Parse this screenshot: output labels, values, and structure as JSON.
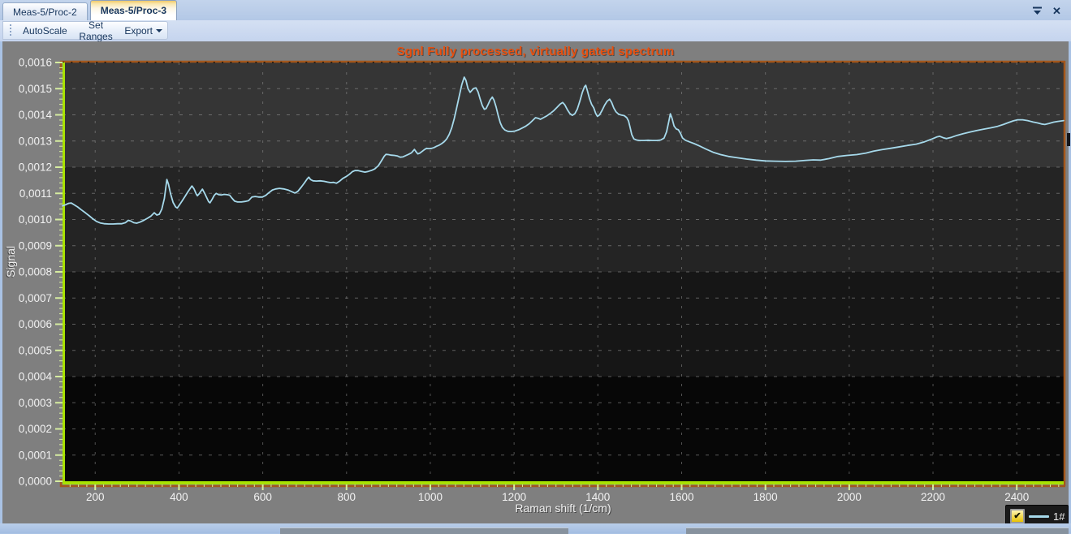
{
  "tab_bar": {
    "tabs": [
      {
        "label": "Meas-5/Proc-2",
        "active": false
      },
      {
        "label": "Meas-5/Proc-3",
        "active": true
      }
    ]
  },
  "toolbar": {
    "autoscale_label": "AutoScale",
    "set_ranges_label": "Set Ranges",
    "export_label": "Export"
  },
  "chart_data": {
    "type": "line",
    "title": "Sgnl Fully processed, virtually gated spectrum",
    "title_color": "#e8500f",
    "xlabel": "Raman shift (1/cm)",
    "ylabel": "Signal",
    "xlim": [
      122,
      2512
    ],
    "ylim": [
      0,
      0.0016
    ],
    "x_tick_start": 200,
    "x_tick_step": 200,
    "x_tick_end": 2400,
    "x_minor_step": 20,
    "y_tick_step": 0.0001,
    "y_minor_step": 2e-05,
    "y_decimals": 4,
    "decimal_separator": ",",
    "grid": "dashed",
    "grid_color": "#9a9a9a",
    "axis_color": "#a8e202",
    "tick_color": "#d6eda0",
    "frame_color": "#a4571c",
    "label_color": "#f2f2f2",
    "plot_bands": [
      {
        "from": 0.0012,
        "to": 0.0016,
        "color": "#353535"
      },
      {
        "from": 0.0008,
        "to": 0.0012,
        "color": "#242424"
      },
      {
        "from": 0.0004,
        "to": 0.0008,
        "color": "#161616"
      },
      {
        "from": 0.0,
        "to": 0.0004,
        "color": "#070707"
      }
    ],
    "legend": {
      "position": "bottom-right",
      "entries": [
        {
          "label": "1#",
          "checked": true,
          "checkbox_color": "#e9c300"
        }
      ]
    },
    "series": [
      {
        "name": "1#",
        "color": "#a6d9eb",
        "points": [
          [
            122,
            0.001052
          ],
          [
            130,
            0.001057
          ],
          [
            137,
            0.001062
          ],
          [
            143,
            0.001063
          ],
          [
            150,
            0.001056
          ],
          [
            158,
            0.001048
          ],
          [
            166,
            0.001038
          ],
          [
            177,
            0.001025
          ],
          [
            186,
            0.001014
          ],
          [
            195,
            0.001002
          ],
          [
            203,
            0.000993
          ],
          [
            212,
            0.000987
          ],
          [
            222,
            0.000984
          ],
          [
            232,
            0.000983
          ],
          [
            243,
            0.000983
          ],
          [
            254,
            0.000984
          ],
          [
            263,
            0.000984
          ],
          [
            272,
            0.000988
          ],
          [
            279,
            0.000997
          ],
          [
            285,
            0.000994
          ],
          [
            292,
            0.000988
          ],
          [
            299,
            0.000986
          ],
          [
            307,
            0.00099
          ],
          [
            316,
            0.000997
          ],
          [
            325,
            0.001005
          ],
          [
            333,
            0.001013
          ],
          [
            341,
            0.001026
          ],
          [
            347,
            0.001017
          ],
          [
            353,
            0.00102
          ],
          [
            359,
            0.00104
          ],
          [
            365,
            0.00108
          ],
          [
            371,
            0.001153
          ],
          [
            375,
            0.001135
          ],
          [
            380,
            0.001098
          ],
          [
            386,
            0.001065
          ],
          [
            392,
            0.001048
          ],
          [
            396,
            0.001044
          ],
          [
            402,
            0.001058
          ],
          [
            408,
            0.001072
          ],
          [
            415,
            0.00109
          ],
          [
            422,
            0.001108
          ],
          [
            428,
            0.001122
          ],
          [
            431,
            0.001128
          ],
          [
            436,
            0.001117
          ],
          [
            441,
            0.001098
          ],
          [
            444,
            0.001091
          ],
          [
            448,
            0.001098
          ],
          [
            453,
            0.00111
          ],
          [
            456,
            0.001116
          ],
          [
            461,
            0.001101
          ],
          [
            466,
            0.001084
          ],
          [
            471,
            0.001068
          ],
          [
            474,
            0.001064
          ],
          [
            479,
            0.001077
          ],
          [
            484,
            0.001092
          ],
          [
            489,
            0.0011
          ],
          [
            495,
            0.001095
          ],
          [
            501,
            0.001094
          ],
          [
            508,
            0.001096
          ],
          [
            515,
            0.001095
          ],
          [
            521,
            0.001093
          ],
          [
            527,
            0.001081
          ],
          [
            533,
            0.00107
          ],
          [
            540,
            0.001067
          ],
          [
            549,
            0.001067
          ],
          [
            558,
            0.001069
          ],
          [
            566,
            0.001072
          ],
          [
            574,
            0.001086
          ],
          [
            582,
            0.001088
          ],
          [
            590,
            0.001086
          ],
          [
            599,
            0.001086
          ],
          [
            607,
            0.001092
          ],
          [
            615,
            0.001103
          ],
          [
            623,
            0.001113
          ],
          [
            631,
            0.001117
          ],
          [
            640,
            0.001119
          ],
          [
            650,
            0.001117
          ],
          [
            660,
            0.001113
          ],
          [
            670,
            0.001106
          ],
          [
            677,
            0.001101
          ],
          [
            684,
            0.001108
          ],
          [
            692,
            0.001124
          ],
          [
            700,
            0.001141
          ],
          [
            706,
            0.001155
          ],
          [
            710,
            0.001162
          ],
          [
            714,
            0.001153
          ],
          [
            720,
            0.001148
          ],
          [
            728,
            0.001147
          ],
          [
            737,
            0.001148
          ],
          [
            746,
            0.001146
          ],
          [
            755,
            0.001143
          ],
          [
            762,
            0.001141
          ],
          [
            769,
            0.001142
          ],
          [
            776,
            0.001139
          ],
          [
            783,
            0.001146
          ],
          [
            791,
            0.001157
          ],
          [
            799,
            0.001164
          ],
          [
            807,
            0.001173
          ],
          [
            814,
            0.001183
          ],
          [
            820,
            0.001187
          ],
          [
            828,
            0.001187
          ],
          [
            836,
            0.001184
          ],
          [
            844,
            0.001181
          ],
          [
            852,
            0.001184
          ],
          [
            860,
            0.001188
          ],
          [
            868,
            0.001194
          ],
          [
            876,
            0.001206
          ],
          [
            884,
            0.001226
          ],
          [
            890,
            0.001242
          ],
          [
            894,
            0.001249
          ],
          [
            900,
            0.001248
          ],
          [
            907,
            0.001246
          ],
          [
            914,
            0.001245
          ],
          [
            921,
            0.001243
          ],
          [
            928,
            0.001238
          ],
          [
            934,
            0.001239
          ],
          [
            941,
            0.001244
          ],
          [
            948,
            0.001249
          ],
          [
            955,
            0.001255
          ],
          [
            960,
            0.001264
          ],
          [
            962,
            0.001268
          ],
          [
            966,
            0.001259
          ],
          [
            970,
            0.001251
          ],
          [
            975,
            0.001254
          ],
          [
            981,
            0.001261
          ],
          [
            986,
            0.001267
          ],
          [
            991,
            0.001272
          ],
          [
            997,
            0.001271
          ],
          [
            1003,
            0.001272
          ],
          [
            1009,
            0.001275
          ],
          [
            1015,
            0.00128
          ],
          [
            1021,
            0.001284
          ],
          [
            1027,
            0.00129
          ],
          [
            1033,
            0.001297
          ],
          [
            1039,
            0.001308
          ],
          [
            1045,
            0.001325
          ],
          [
            1051,
            0.00135
          ],
          [
            1057,
            0.001385
          ],
          [
            1063,
            0.001428
          ],
          [
            1069,
            0.001472
          ],
          [
            1075,
            0.001515
          ],
          [
            1081,
            0.001544
          ],
          [
            1085,
            0.001532
          ],
          [
            1090,
            0.0015
          ],
          [
            1095,
            0.001486
          ],
          [
            1099,
            0.001493
          ],
          [
            1104,
            0.001501
          ],
          [
            1109,
            0.001503
          ],
          [
            1114,
            0.001487
          ],
          [
            1119,
            0.00146
          ],
          [
            1124,
            0.001436
          ],
          [
            1129,
            0.001421
          ],
          [
            1133,
            0.001424
          ],
          [
            1138,
            0.00144
          ],
          [
            1143,
            0.001457
          ],
          [
            1148,
            0.001468
          ],
          [
            1152,
            0.001456
          ],
          [
            1157,
            0.00143
          ],
          [
            1162,
            0.001398
          ],
          [
            1167,
            0.00137
          ],
          [
            1172,
            0.001352
          ],
          [
            1178,
            0.001342
          ],
          [
            1185,
            0.001337
          ],
          [
            1193,
            0.001336
          ],
          [
            1202,
            0.001338
          ],
          [
            1211,
            0.001343
          ],
          [
            1220,
            0.00135
          ],
          [
            1228,
            0.001357
          ],
          [
            1236,
            0.001366
          ],
          [
            1244,
            0.001378
          ],
          [
            1251,
            0.001389
          ],
          [
            1257,
            0.001387
          ],
          [
            1263,
            0.001383
          ],
          [
            1270,
            0.001389
          ],
          [
            1278,
            0.001396
          ],
          [
            1286,
            0.001405
          ],
          [
            1294,
            0.001415
          ],
          [
            1302,
            0.001428
          ],
          [
            1310,
            0.001441
          ],
          [
            1316,
            0.001447
          ],
          [
            1321,
            0.001438
          ],
          [
            1327,
            0.00142
          ],
          [
            1333,
            0.001405
          ],
          [
            1339,
            0.001398
          ],
          [
            1345,
            0.001404
          ],
          [
            1351,
            0.001422
          ],
          [
            1357,
            0.001452
          ],
          [
            1363,
            0.001486
          ],
          [
            1368,
            0.001507
          ],
          [
            1371,
            0.001513
          ],
          [
            1375,
            0.001492
          ],
          [
            1380,
            0.001462
          ],
          [
            1385,
            0.00144
          ],
          [
            1390,
            0.001427
          ],
          [
            1395,
            0.001405
          ],
          [
            1399,
            0.001394
          ],
          [
            1404,
            0.0014
          ],
          [
            1410,
            0.001417
          ],
          [
            1416,
            0.001437
          ],
          [
            1422,
            0.001452
          ],
          [
            1428,
            0.00146
          ],
          [
            1433,
            0.001447
          ],
          [
            1438,
            0.001426
          ],
          [
            1443,
            0.001412
          ],
          [
            1449,
            0.001403
          ],
          [
            1456,
            0.001399
          ],
          [
            1463,
            0.001397
          ],
          [
            1469,
            0.001389
          ],
          [
            1473,
            0.001377
          ],
          [
            1477,
            0.001352
          ],
          [
            1481,
            0.001324
          ],
          [
            1486,
            0.001308
          ],
          [
            1492,
            0.001304
          ],
          [
            1500,
            0.001302
          ],
          [
            1510,
            0.001302
          ],
          [
            1520,
            0.001303
          ],
          [
            1530,
            0.001302
          ],
          [
            1540,
            0.001302
          ],
          [
            1550,
            0.001304
          ],
          [
            1558,
            0.001311
          ],
          [
            1564,
            0.001335
          ],
          [
            1569,
            0.001372
          ],
          [
            1573,
            0.001404
          ],
          [
            1577,
            0.001387
          ],
          [
            1582,
            0.001357
          ],
          [
            1587,
            0.001346
          ],
          [
            1592,
            0.001343
          ],
          [
            1597,
            0.00133
          ],
          [
            1602,
            0.001312
          ],
          [
            1609,
            0.001303
          ],
          [
            1618,
            0.001297
          ],
          [
            1630,
            0.00129
          ],
          [
            1643,
            0.001281
          ],
          [
            1658,
            0.001269
          ],
          [
            1675,
            0.001257
          ],
          [
            1693,
            0.001248
          ],
          [
            1712,
            0.001241
          ],
          [
            1733,
            0.001236
          ],
          [
            1755,
            0.001231
          ],
          [
            1778,
            0.001227
          ],
          [
            1800,
            0.001224
          ],
          [
            1823,
            0.001223
          ],
          [
            1848,
            0.001222
          ],
          [
            1872,
            0.001223
          ],
          [
            1896,
            0.001226
          ],
          [
            1914,
            0.001228
          ],
          [
            1932,
            0.001227
          ],
          [
            1952,
            0.001233
          ],
          [
            1973,
            0.001241
          ],
          [
            1995,
            0.001245
          ],
          [
            2018,
            0.001248
          ],
          [
            2040,
            0.001254
          ],
          [
            2058,
            0.001261
          ],
          [
            2078,
            0.001267
          ],
          [
            2098,
            0.001272
          ],
          [
            2117,
            0.001277
          ],
          [
            2139,
            0.001283
          ],
          [
            2160,
            0.001288
          ],
          [
            2180,
            0.001297
          ],
          [
            2198,
            0.001308
          ],
          [
            2210,
            0.001316
          ],
          [
            2216,
            0.001318
          ],
          [
            2224,
            0.001313
          ],
          [
            2232,
            0.001309
          ],
          [
            2244,
            0.001314
          ],
          [
            2258,
            0.001322
          ],
          [
            2272,
            0.001328
          ],
          [
            2288,
            0.001334
          ],
          [
            2304,
            0.00134
          ],
          [
            2320,
            0.001345
          ],
          [
            2337,
            0.00135
          ],
          [
            2354,
            0.001356
          ],
          [
            2368,
            0.001363
          ],
          [
            2381,
            0.001371
          ],
          [
            2392,
            0.001377
          ],
          [
            2402,
            0.001381
          ],
          [
            2414,
            0.001381
          ],
          [
            2426,
            0.001378
          ],
          [
            2438,
            0.001373
          ],
          [
            2450,
            0.001369
          ],
          [
            2459,
            0.001365
          ],
          [
            2467,
            0.001363
          ],
          [
            2477,
            0.001367
          ],
          [
            2488,
            0.001372
          ],
          [
            2498,
            0.001375
          ],
          [
            2512,
            0.001378
          ]
        ]
      }
    ]
  }
}
